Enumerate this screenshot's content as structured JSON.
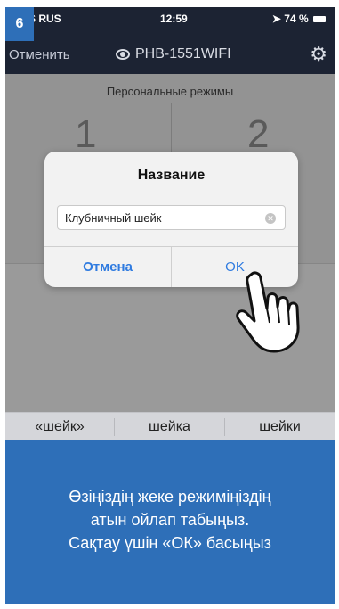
{
  "step_number": "6",
  "status_bar": {
    "carrier": "S RUS",
    "time": "12:59",
    "battery": "74 %"
  },
  "nav": {
    "cancel_label": "Отменить",
    "device_name": "PHB-1551WIFI"
  },
  "section_title": "Персональные режимы",
  "modes": [
    "1",
    "2"
  ],
  "dialog": {
    "title": "Название",
    "input_value": "Клубничный шейк",
    "cancel_label": "Отмена",
    "ok_label": "OK"
  },
  "suggestions": [
    "«шейк»",
    "шейка",
    "шейки"
  ],
  "instruction_lines": [
    "Өзіңіздің жеке режиміңіздің",
    "атын ойлап табыңыз.",
    "Сақтау үшін «ОК» басыңыз"
  ],
  "colors": {
    "badge_blue": "#2e6fb8",
    "header_dark": "#1c2333",
    "ios_blue": "#2f7be0"
  }
}
